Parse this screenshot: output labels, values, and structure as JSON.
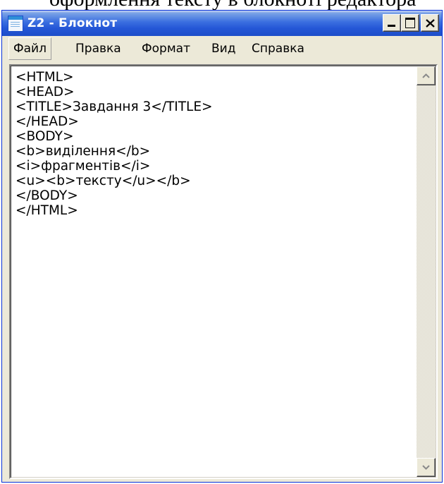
{
  "document_fragment": "оформлення тексту в блокноті редактора",
  "window": {
    "title": "Z2 - Блокнот",
    "icon": "notepad-icon"
  },
  "caption_buttons": {
    "minimize_icon": "minimize-icon",
    "maximize_icon": "maximize-icon",
    "close_icon": "close-icon"
  },
  "menu": {
    "items": [
      {
        "label": "Файл",
        "active": true
      },
      {
        "label": "Правка",
        "active": false
      },
      {
        "label": "Формат",
        "active": false
      },
      {
        "label": "Вид",
        "active": false
      },
      {
        "label": "Справка",
        "active": false
      }
    ]
  },
  "editor": {
    "lines": [
      "<HTML>",
      "<HEAD>",
      "<TITLE>Завдання 3</TITLE>",
      "</HEAD>",
      "<BODY>",
      "<b>виділення</b>",
      "<i>фрагментів</i>",
      "<u><b>тексту</u></b>",
      "</BODY>",
      "</HTML>"
    ]
  },
  "scrollbar": {
    "up_icon": "arrow-up-icon",
    "down_icon": "arrow-down-icon"
  }
}
